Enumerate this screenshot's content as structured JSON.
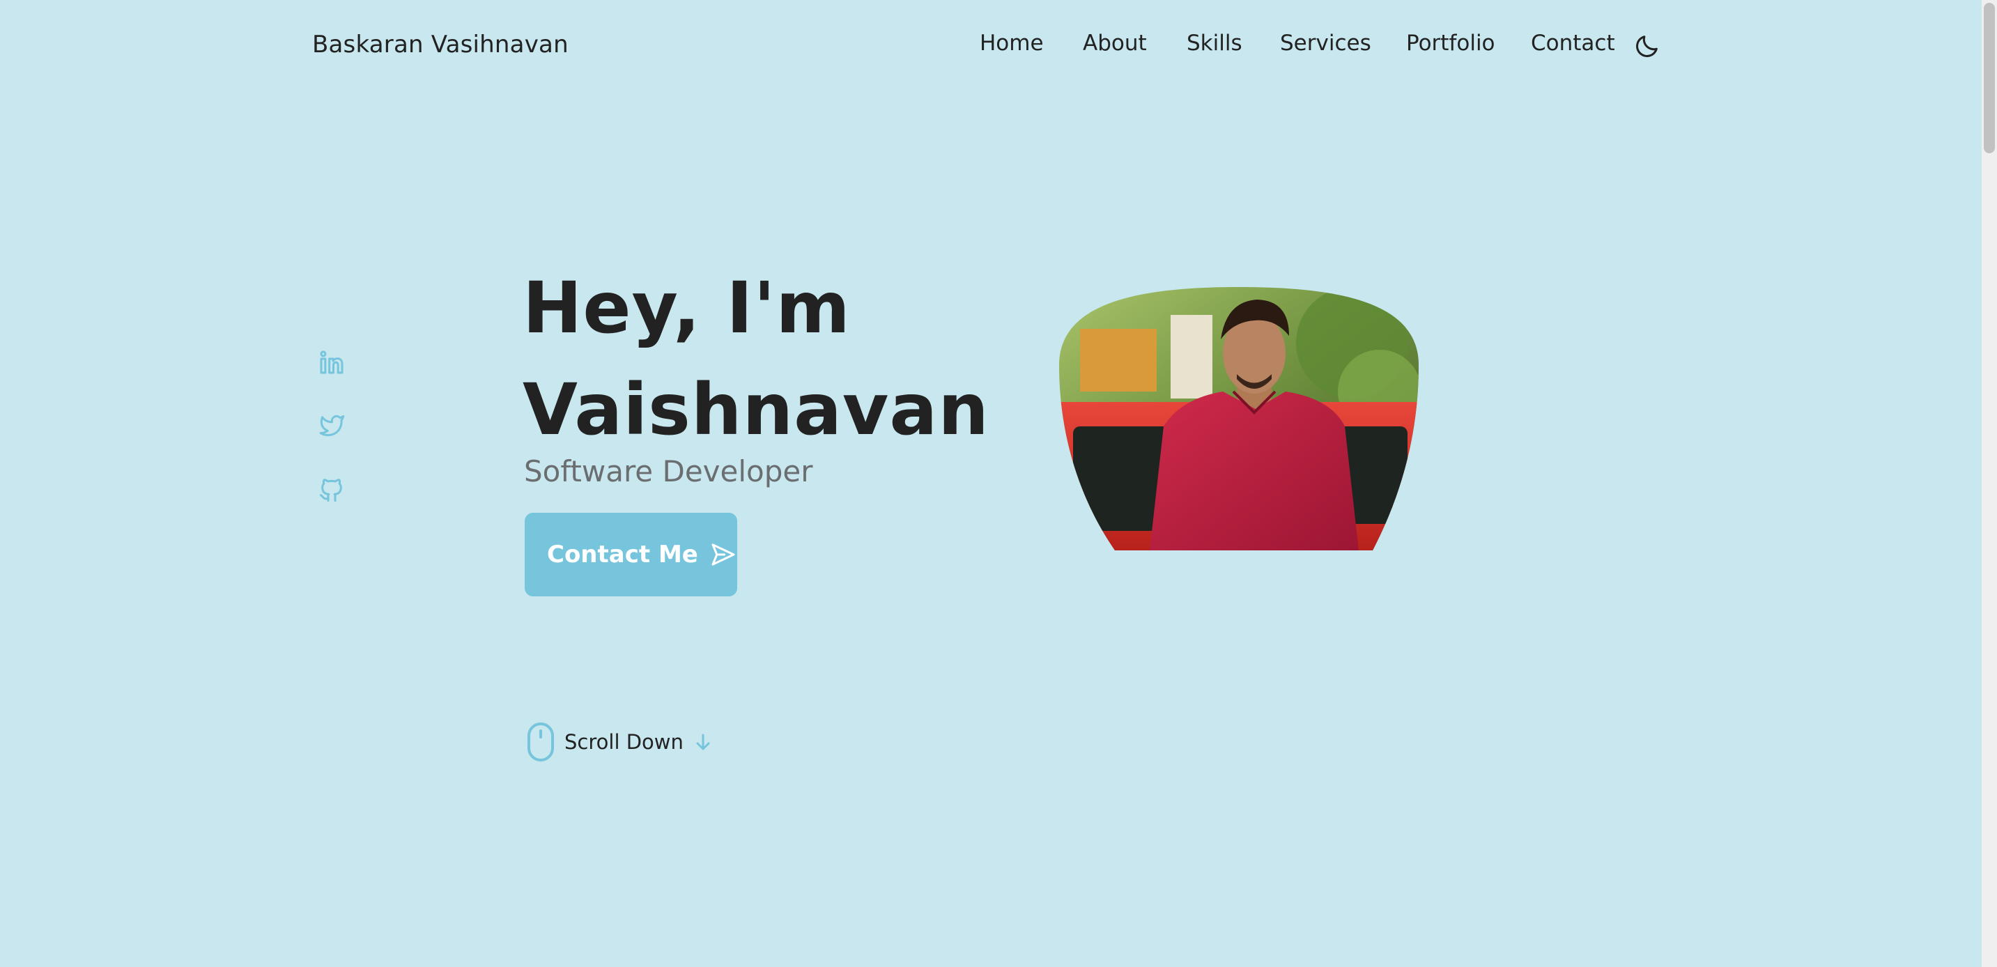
{
  "header": {
    "brand": "Baskaran Vasihnavan",
    "nav": [
      "Home",
      "About",
      "Skills",
      "Services",
      "Portfolio",
      "Contact"
    ],
    "theme_toggle_icon": "moon-icon"
  },
  "socials": [
    {
      "icon": "linkedin-icon"
    },
    {
      "icon": "twitter-icon"
    },
    {
      "icon": "github-icon"
    }
  ],
  "hero": {
    "title_line1": "Hey, I'm",
    "title_line2": "Vaishnavan",
    "subtitle": "Software Developer",
    "cta_label": "Contact Me",
    "cta_icon": "send-icon"
  },
  "scroll": {
    "label": "Scroll Down",
    "icon": "mouse-icon",
    "arrow_icon": "arrow-down-icon"
  },
  "colors": {
    "background": "#c8e7ee",
    "accent": "#76c5dd",
    "text": "#222222",
    "subtitle": "#6b6e70"
  }
}
